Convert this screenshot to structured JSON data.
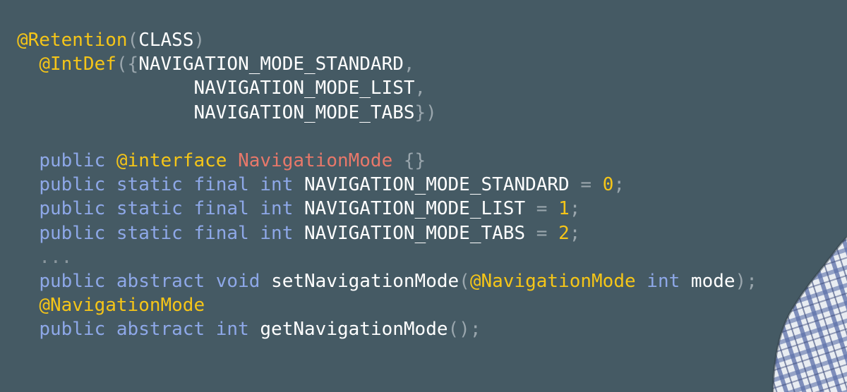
{
  "code": {
    "l1": {
      "a": "@Retention",
      "b": "(",
      "c": "CLASS",
      "d": ")"
    },
    "l2": {
      "a": "@IntDef",
      "b": "({",
      "c": "NAVIGATION_MODE_STANDARD",
      "d": ","
    },
    "l3": {
      "c": "NAVIGATION_MODE_LIST",
      "d": ","
    },
    "l4": {
      "c": "NAVIGATION_MODE_TABS",
      "d": "})"
    },
    "l6": {
      "kw1": "public",
      "ann": "@interface",
      "cls": "NavigationMode",
      "br": "{}"
    },
    "l7": {
      "kw1": "public",
      "kw2": "static",
      "kw3": "final",
      "kw4": "int",
      "name": "NAVIGATION_MODE_STANDARD",
      "eq": "=",
      "val": "0",
      "semi": ";"
    },
    "l8": {
      "kw1": "public",
      "kw2": "static",
      "kw3": "final",
      "kw4": "int",
      "name": "NAVIGATION_MODE_LIST",
      "eq": "=",
      "val": "1",
      "semi": ";"
    },
    "l9": {
      "kw1": "public",
      "kw2": "static",
      "kw3": "final",
      "kw4": "int",
      "name": "NAVIGATION_MODE_TABS",
      "eq": "=",
      "val": "2",
      "semi": ";"
    },
    "l10": {
      "ellipsis": "..."
    },
    "l11": {
      "kw1": "public",
      "kw2": "abstract",
      "kw3": "void",
      "name": "setNavigationMode",
      "p1": "(",
      "ann": "@NavigationMode",
      "kw4": "int",
      "param": "mode",
      "p2": ");"
    },
    "l12": {
      "ann": "@NavigationMode"
    },
    "l13": {
      "kw1": "public",
      "kw2": "abstract",
      "kw3": "int",
      "name": "getNavigationMode",
      "p": "();"
    }
  },
  "colors": {
    "background": "#455a64",
    "annotation": "#f5c518",
    "keyword": "#8ea8e8",
    "class_name": "#e8786a",
    "identifier": "#ffffff",
    "punctuation": "#9aa6ad"
  },
  "presenter": {
    "icon": "presenter-shirt-icon"
  }
}
